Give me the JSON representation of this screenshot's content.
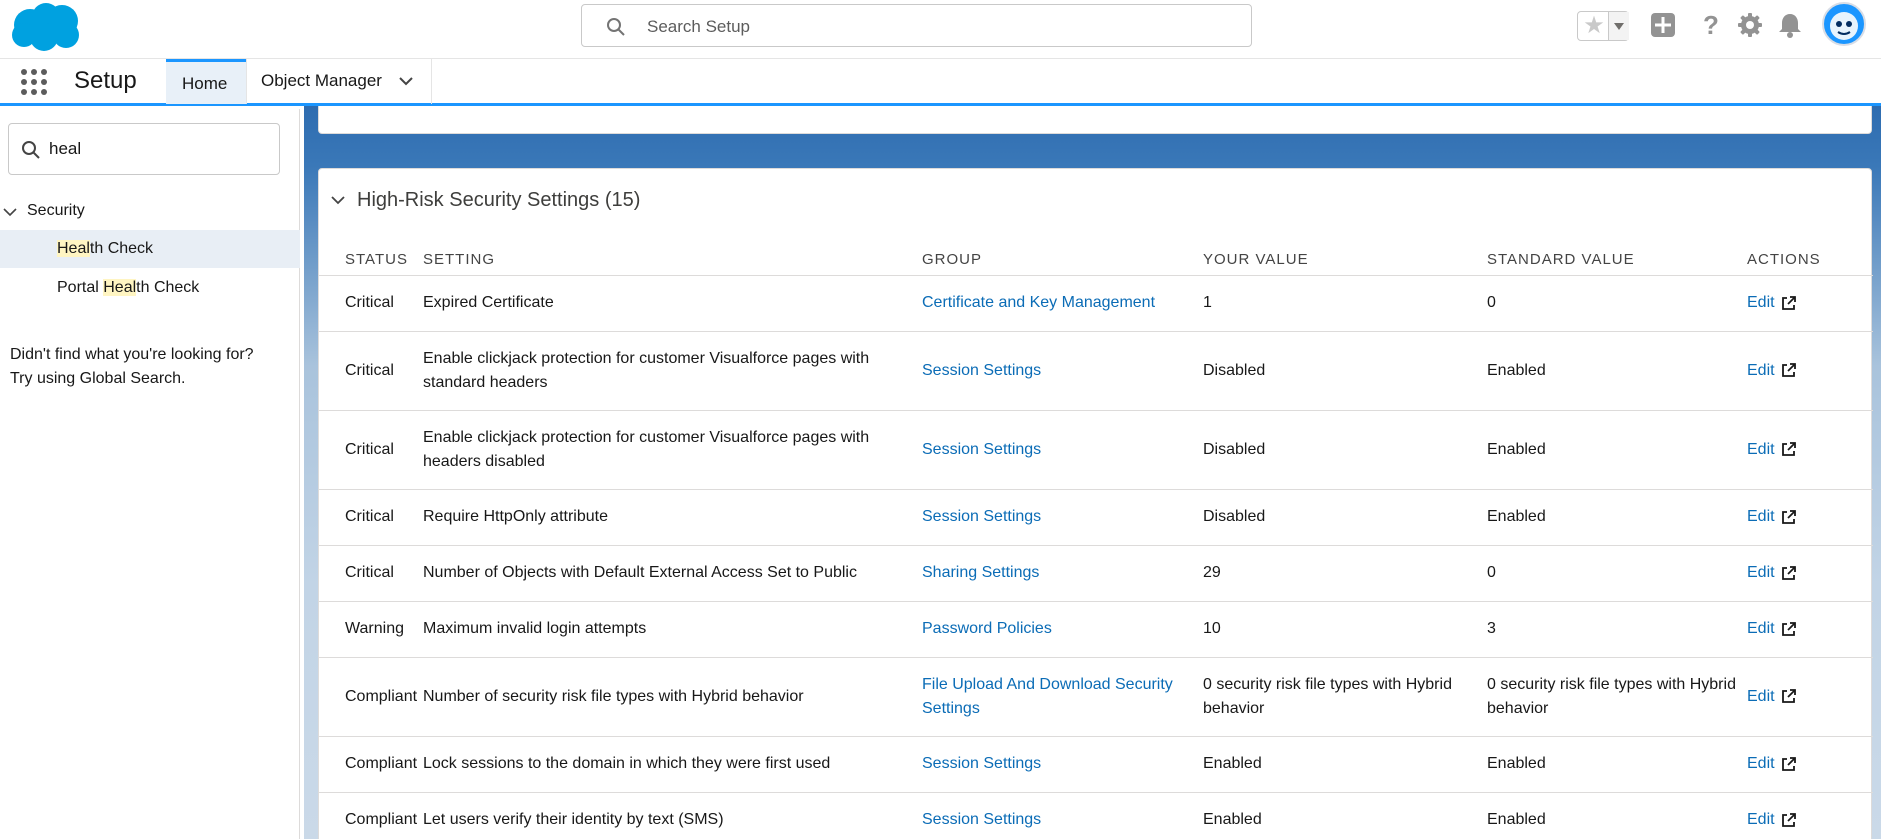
{
  "header": {
    "search_placeholder": "Search Setup",
    "icons": [
      "salesforce-logo",
      "search-icon",
      "star-icon",
      "add-icon",
      "help-icon",
      "gear-icon",
      "bell-icon",
      "avatar"
    ]
  },
  "context_bar": {
    "app_name": "Setup",
    "tabs": [
      {
        "label": "Home",
        "active": true
      },
      {
        "label": "Object Manager",
        "active": false
      }
    ]
  },
  "sidebar": {
    "quick_find_value": "heal",
    "section": "Security",
    "items": [
      {
        "pre": "",
        "match": "Heal",
        "post": "th Check",
        "active": true
      },
      {
        "pre": "Portal ",
        "match": "Heal",
        "post": "th Check",
        "active": false
      }
    ],
    "help_line1": "Didn't find what you're looking for?",
    "help_line2": "Try using Global Search."
  },
  "card": {
    "title": "High-Risk Security Settings (15)",
    "columns": [
      "STATUS",
      "SETTING",
      "GROUP",
      "YOUR VALUE",
      "STANDARD VALUE",
      "ACTIONS"
    ],
    "rows": [
      {
        "status": "Critical",
        "setting": "Expired Certificate",
        "group": "Certificate and Key Management",
        "your_value": "1",
        "standard_value": "0",
        "action": "Edit"
      },
      {
        "status": "Critical",
        "setting": "Enable clickjack protection for customer Visualforce pages with standard headers",
        "group": "Session Settings",
        "your_value": "Disabled",
        "standard_value": "Enabled",
        "action": "Edit"
      },
      {
        "status": "Critical",
        "setting": "Enable clickjack protection for customer Visualforce pages with headers disabled",
        "group": "Session Settings",
        "your_value": "Disabled",
        "standard_value": "Enabled",
        "action": "Edit"
      },
      {
        "status": "Critical",
        "setting": "Require HttpOnly attribute",
        "group": "Session Settings",
        "your_value": "Disabled",
        "standard_value": "Enabled",
        "action": "Edit"
      },
      {
        "status": "Critical",
        "setting": "Number of Objects with Default External Access Set to Public",
        "group": "Sharing Settings",
        "your_value": "29",
        "standard_value": "0",
        "action": "Edit"
      },
      {
        "status": "Warning",
        "setting": "Maximum invalid login attempts",
        "group": "Password Policies",
        "your_value": "10",
        "standard_value": "3",
        "action": "Edit"
      },
      {
        "status": "Compliant",
        "setting": "Number of security risk file types with Hybrid behavior",
        "group": "File Upload And Download Security Settings",
        "your_value": "0 security risk file types with Hybrid behavior",
        "standard_value": "0 security risk file types with Hybrid behavior",
        "action": "Edit"
      },
      {
        "status": "Compliant",
        "setting": "Lock sessions to the domain in which they were first used",
        "group": "Session Settings",
        "your_value": "Enabled",
        "standard_value": "Enabled",
        "action": "Edit"
      },
      {
        "status": "Compliant",
        "setting": "Let users verify their identity by text (SMS)",
        "group": "Session Settings",
        "your_value": "Enabled",
        "standard_value": "Enabled",
        "action": "Edit"
      }
    ]
  },
  "colors": {
    "brand": "#00a1e0",
    "link": "#0b6cb6",
    "critical": "#a24a35",
    "warning": "#9c5a22",
    "compliant": "#2e6b5c"
  }
}
